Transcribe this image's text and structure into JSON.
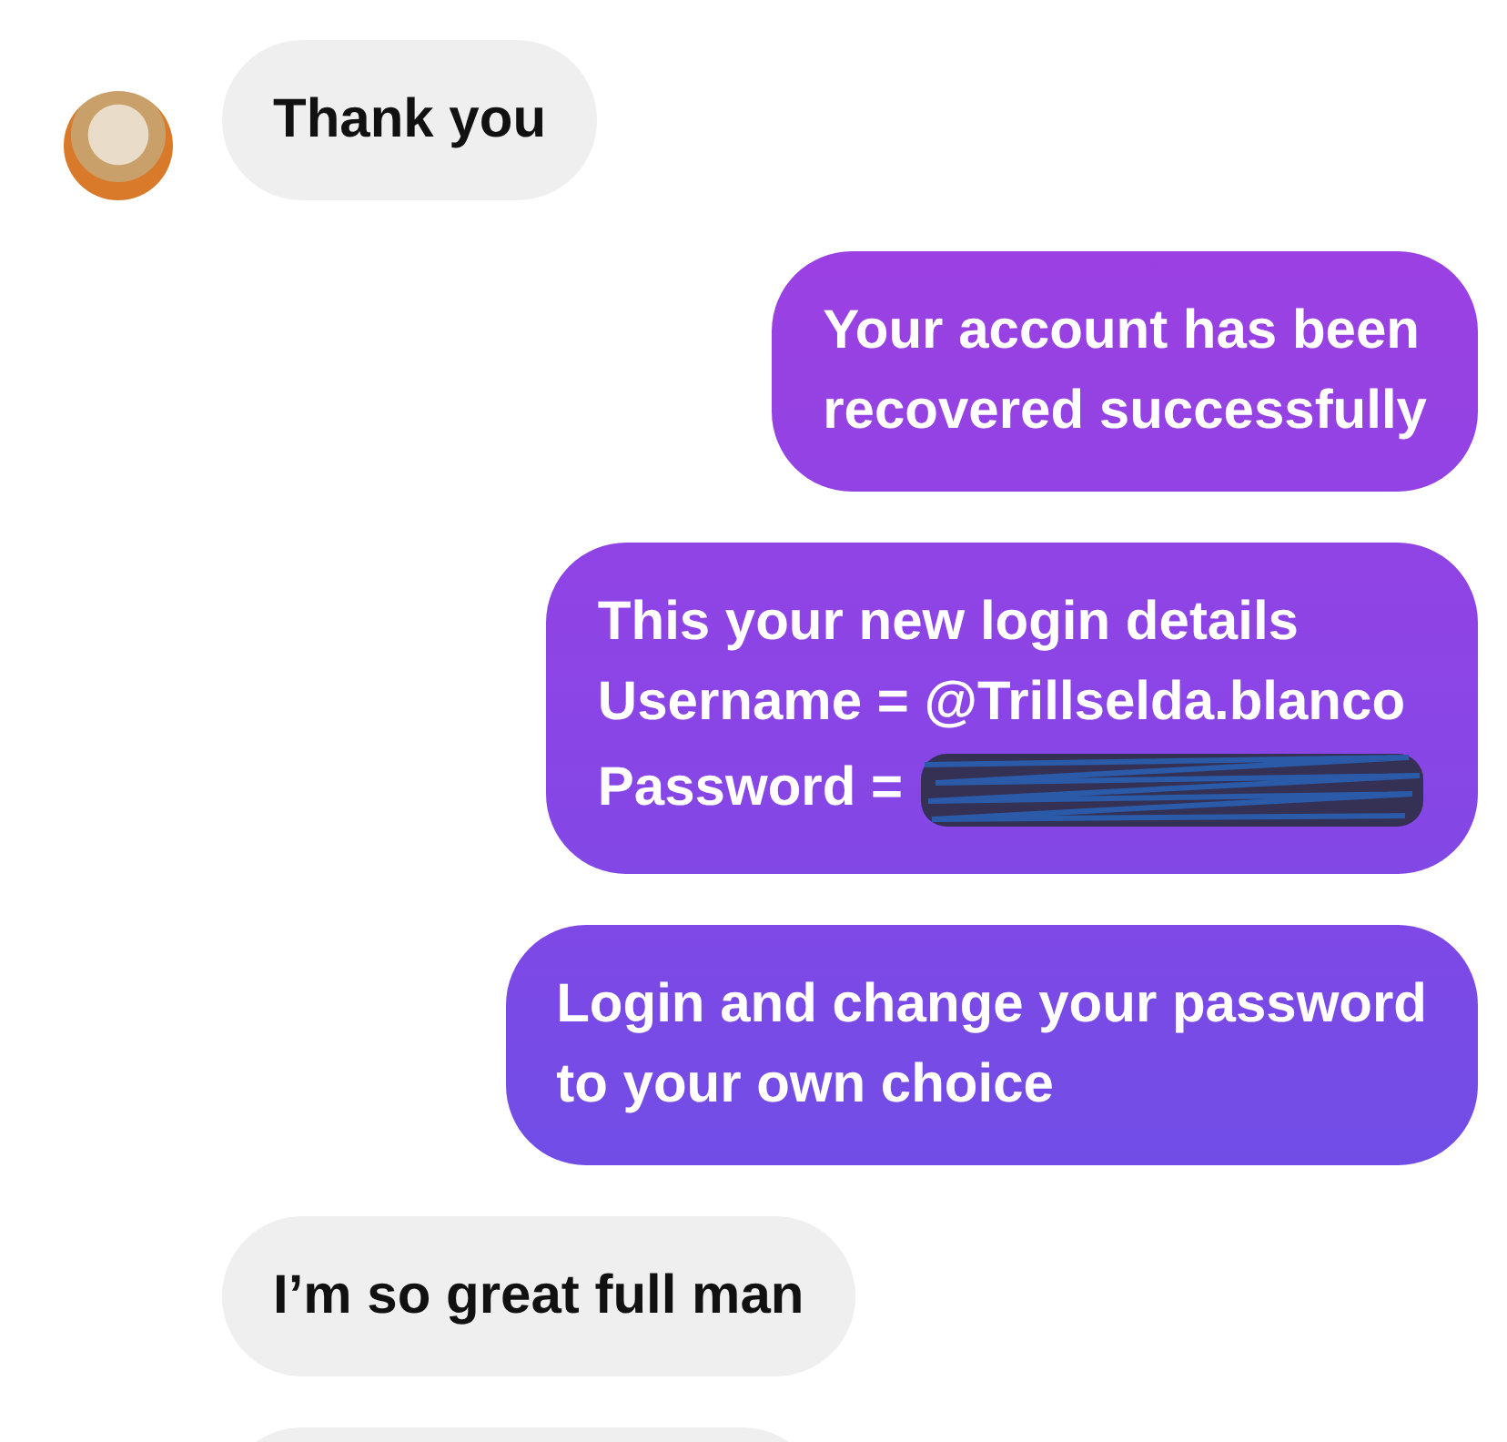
{
  "messages": [
    {
      "outgoing": false,
      "avatar": true,
      "lines": [
        "Thank you"
      ]
    },
    {
      "outgoing": true,
      "lines": [
        "Your account has been",
        "recovered successfully"
      ]
    },
    {
      "outgoing": true,
      "lines": [
        "This your new login details",
        "Username = @Trillselda.blanco",
        "Password ="
      ],
      "redacted": true
    },
    {
      "outgoing": true,
      "lines": [
        "Login and change your password",
        "to your own choice"
      ]
    },
    {
      "outgoing": false,
      "avatar": false,
      "lines": [
        "I’m so great full man"
      ]
    },
    {
      "outgoing": false,
      "avatar": false,
      "kind": "cut"
    }
  ]
}
